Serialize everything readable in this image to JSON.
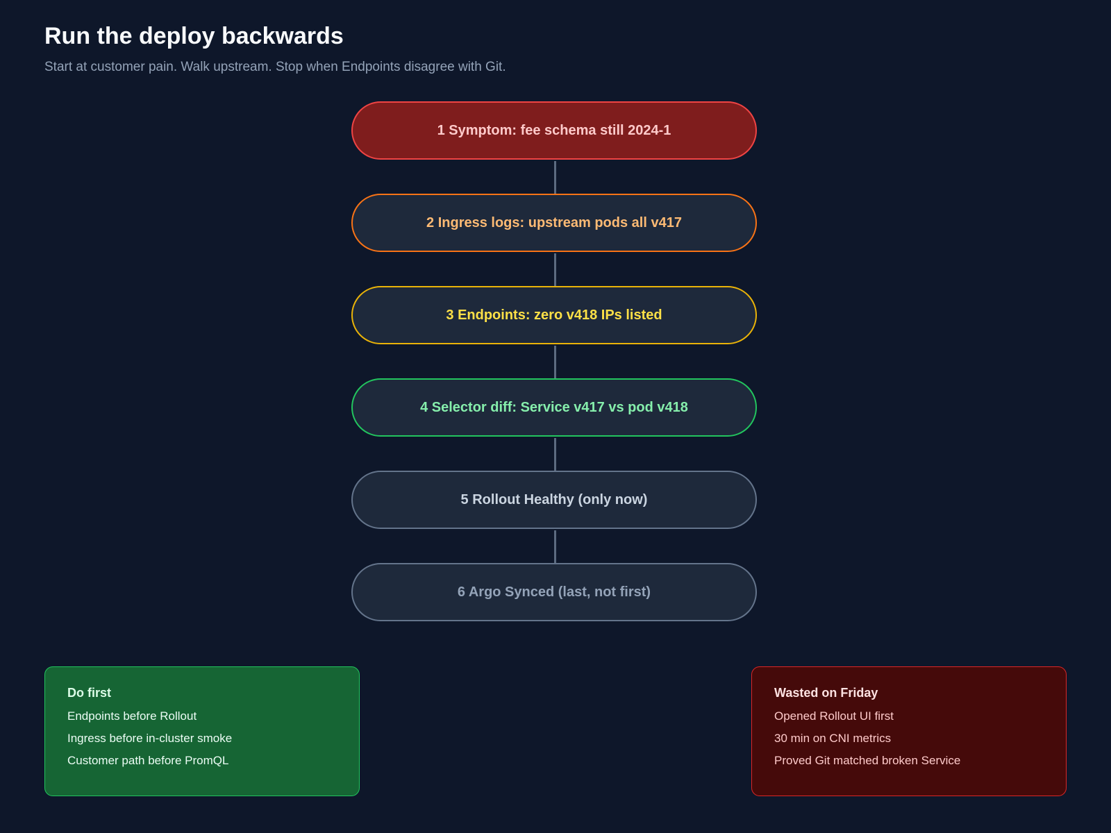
{
  "header": {
    "title": "Run the deploy backwards",
    "subtitle": "Start at customer pain. Walk upstream. Stop when Endpoints disagree with Git."
  },
  "steps": [
    {
      "label": "1 Symptom: fee schema still 2024-1",
      "border": "#ef4444",
      "fill": "#7f1d1d",
      "text": "#fecaca"
    },
    {
      "label": "2 Ingress logs: upstream pods all v417",
      "border": "#f97316",
      "fill": "#1e293b",
      "text": "#fdba74"
    },
    {
      "label": "3 Endpoints: zero v418 IPs listed",
      "border": "#eab308",
      "fill": "#1e293b",
      "text": "#fde047"
    },
    {
      "label": "4 Selector diff: Service v417 vs pod v418",
      "border": "#22c55e",
      "fill": "#1e293b",
      "text": "#86efac"
    },
    {
      "label": "5 Rollout Healthy (only now)",
      "border": "#64748b",
      "fill": "#1e293b",
      "text": "#cbd5e1"
    },
    {
      "label": "6 Argo Synced (last, not first)",
      "border": "#64748b",
      "fill": "#1e293b",
      "text": "#94a3b8"
    }
  ],
  "do_first": {
    "title": "Do first",
    "items": [
      "Endpoints before Rollout",
      "Ingress before in-cluster smoke",
      "Customer path before PromQL"
    ]
  },
  "wasted": {
    "title": "Wasted on Friday",
    "items": [
      "Opened Rollout UI first",
      "30 min on CNI metrics",
      "Proved Git matched broken Service"
    ]
  }
}
